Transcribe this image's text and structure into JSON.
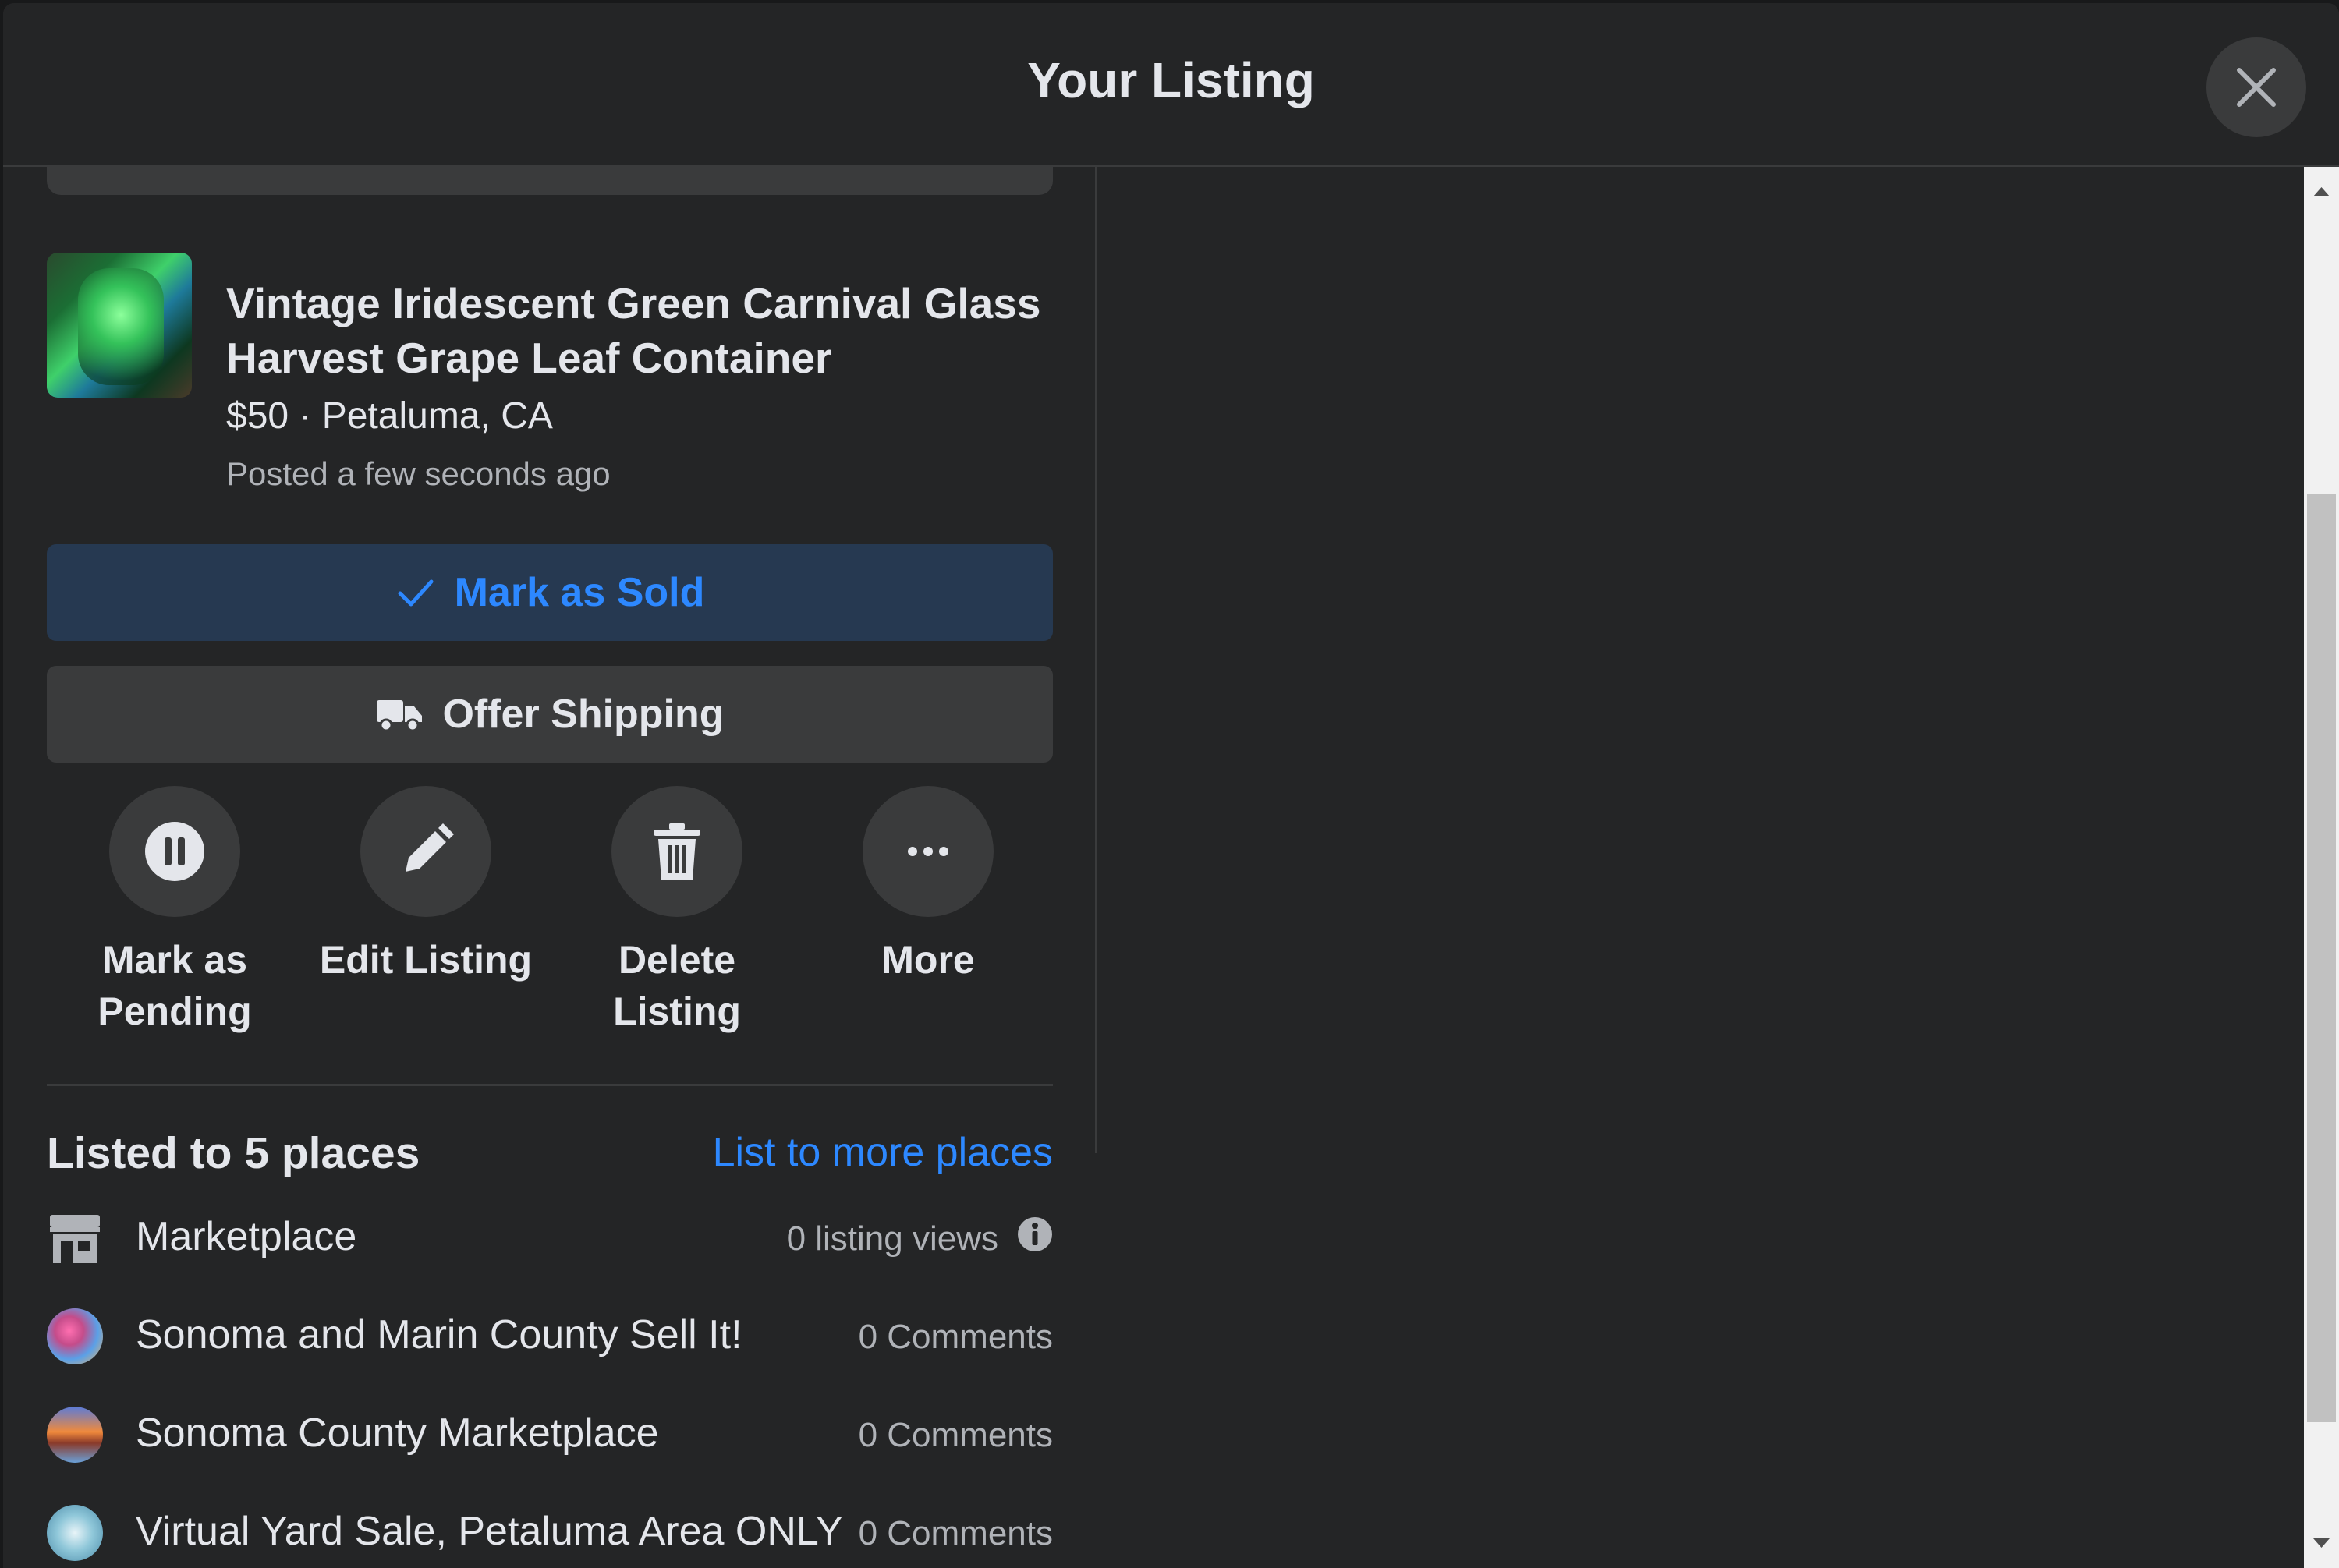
{
  "modal": {
    "title": "Your Listing"
  },
  "listing": {
    "title": "Vintage Iridescent Green Carnival Glass Harvest Grape Leaf Container",
    "price_location": "$50 · Petaluma, CA",
    "posted": "Posted a few seconds ago",
    "thumbnail_icon": "listing-photo"
  },
  "buttons": {
    "mark_sold": "Mark as Sold",
    "offer_shipping": "Offer Shipping"
  },
  "actions": [
    {
      "label": "Mark as Pending",
      "icon": "pause-icon"
    },
    {
      "label": "Edit Listing",
      "icon": "pencil-icon"
    },
    {
      "label": "Delete Listing",
      "icon": "trash-icon"
    },
    {
      "label": "More",
      "icon": "more-icon"
    }
  ],
  "places": {
    "heading": "Listed to 5 places",
    "list_more_link": "List to more places",
    "items": [
      {
        "name": "Marketplace",
        "stat": "0 listing views",
        "icon": "storefront-icon"
      },
      {
        "name": "Sonoma and Marin County Sell It!",
        "stat": "0 Comments",
        "icon": "group-avatar"
      },
      {
        "name": "Sonoma County Marketplace",
        "stat": "0 Comments",
        "icon": "group-avatar"
      },
      {
        "name": "Virtual Yard Sale, Petaluma Area ONLY",
        "stat": "0 Comments",
        "icon": "group-avatar"
      }
    ]
  },
  "colors": {
    "background": "#242526",
    "accent_blue": "#2d88ff",
    "sold_button_bg": "#263951",
    "secondary_button_bg": "#3a3b3c"
  }
}
